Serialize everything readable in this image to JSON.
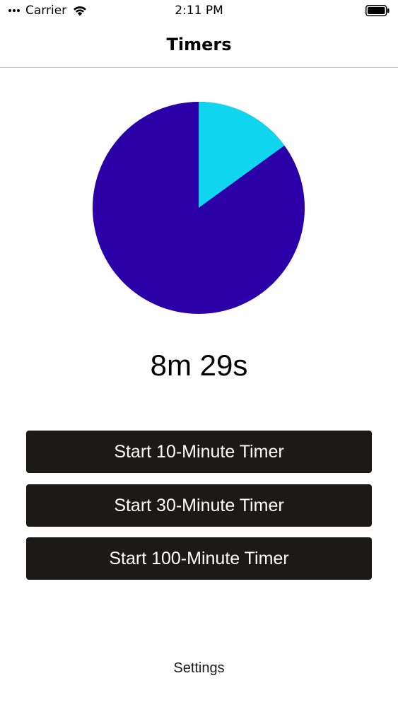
{
  "status_bar": {
    "carrier": "Carrier",
    "time": "2:11 PM",
    "icons": [
      "signal-dots-icon",
      "wifi-icon",
      "battery-icon"
    ]
  },
  "nav": {
    "title": "Timers"
  },
  "timer": {
    "remaining_label": "8m 29s",
    "elapsed_fraction": 0.15,
    "colors": {
      "elapsed": "#0fd5ee",
      "remaining": "#2c00a8"
    }
  },
  "buttons": [
    {
      "label": "Start 10-Minute Timer"
    },
    {
      "label": "Start 30-Minute Timer"
    },
    {
      "label": "Start 100-Minute Timer"
    }
  ],
  "footer": {
    "settings_label": "Settings"
  }
}
